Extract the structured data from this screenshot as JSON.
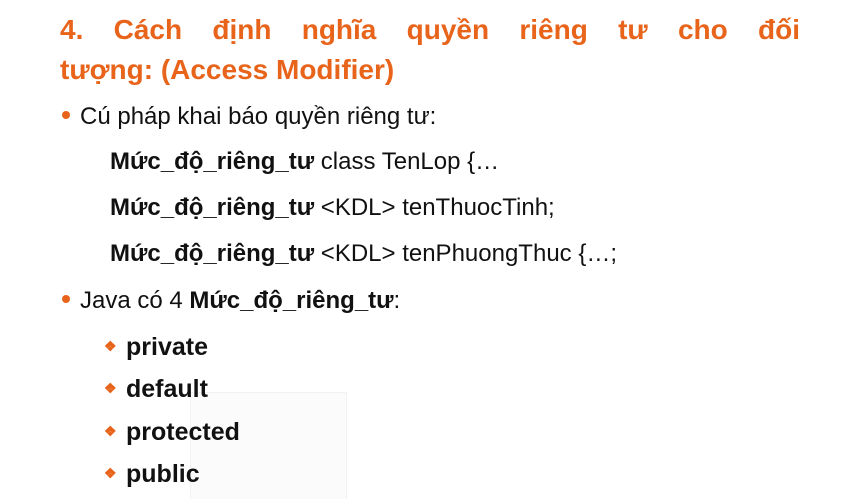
{
  "title": {
    "line1": "4. Cách định nghĩa quyền riêng tư cho đối",
    "line2": "tượng: (Access Modifier)"
  },
  "bullet1": {
    "text": "Cú pháp khai báo quyền riêng tư:"
  },
  "syntax": [
    {
      "keyword": "Mức_độ_riêng_tư",
      "rest": " class TenLop {…"
    },
    {
      "keyword": "Mức_độ_riêng_tư",
      "rest": " <KDL> tenThuocTinh;"
    },
    {
      "keyword": "Mức_độ_riêng_tư",
      "rest": " <KDL> tenPhuongThuc {…;"
    }
  ],
  "bullet2": {
    "prefix": "Java có 4 ",
    "keyword": "Mức_độ_riêng_tư",
    "suffix": ":"
  },
  "modifiers": [
    {
      "label": "private"
    },
    {
      "label": "default"
    },
    {
      "label": "protected"
    },
    {
      "label": "public"
    }
  ],
  "colors": {
    "accent": "#e8641b",
    "text": "#111111",
    "background": "#ffffff"
  },
  "icons": {
    "bullet": "round-bullet-icon",
    "sub_bullet": "diamond-bullet-icon"
  }
}
